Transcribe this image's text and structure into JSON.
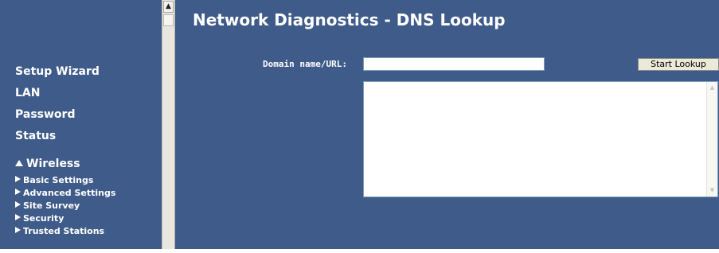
{
  "sidebar": {
    "items": [
      {
        "label": "Setup Wizard"
      },
      {
        "label": "LAN"
      },
      {
        "label": "Password"
      },
      {
        "label": "Status"
      }
    ],
    "wireless": {
      "label": "Wireless",
      "subitems": [
        {
          "label": "Basic Settings"
        },
        {
          "label": "Advanced Settings"
        },
        {
          "label": "Site Survey"
        },
        {
          "label": "Security"
        },
        {
          "label": "Trusted Stations"
        }
      ]
    }
  },
  "main": {
    "title": "Network Diagnostics - DNS Lookup",
    "domain_label": "Domain name/URL:",
    "domain_value": "",
    "start_button": "Start Lookup",
    "result_text": ""
  },
  "colors": {
    "background": "#3f5b8a",
    "text": "#ffffff"
  },
  "icons": {
    "expand": "triangle-up-icon",
    "bullet": "triangle-right-icon",
    "scroll_up": "scroll-up-arrow-icon",
    "scroll_down": "scroll-down-arrow-icon"
  }
}
